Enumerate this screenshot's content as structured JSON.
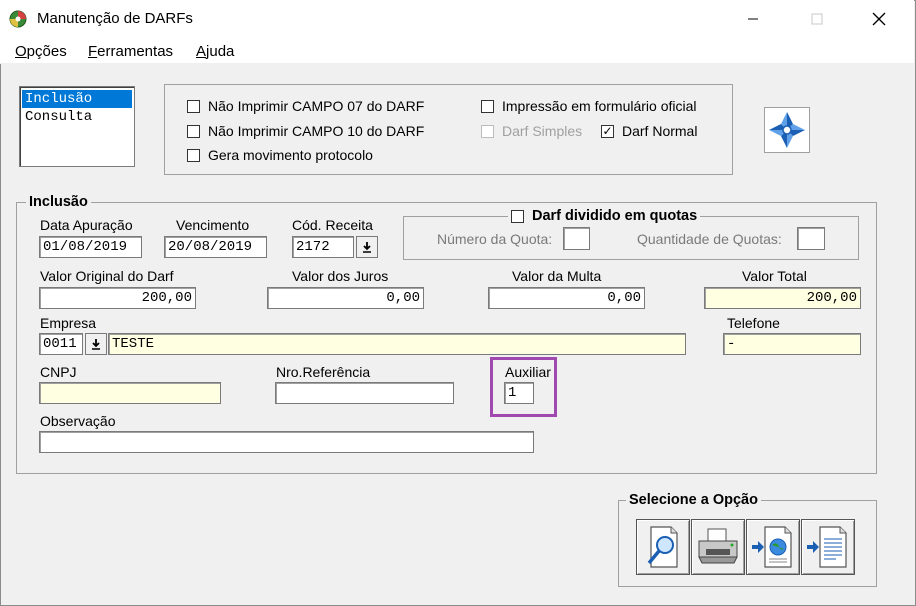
{
  "window": {
    "title": "Manutenção de DARFs",
    "minimize": "—",
    "maximize": "☐",
    "close": "✕"
  },
  "menu": [
    {
      "u": "O",
      "rest": "pções"
    },
    {
      "u": "F",
      "rest": "erramentas"
    },
    {
      "u": "A",
      "rest": "juda"
    }
  ],
  "modes": [
    "Inclusão",
    "Consulta"
  ],
  "options": {
    "nao_imprimir_07": "Não Imprimir CAMPO 07 do DARF",
    "nao_imprimir_10": "Não Imprimir CAMPO 10 do DARF",
    "gera_movimento": "Gera movimento protocolo",
    "impressao_oficial": "Impressão em formulário oficial",
    "darf_simples": "Darf Simples",
    "darf_normal": "Darf Normal",
    "darf_normal_check": "✓"
  },
  "inclusao": {
    "title": "Inclusão",
    "data_apuracao_label": "Data Apuração",
    "data_apuracao": "01/08/2019",
    "vencimento_label": "Vencimento",
    "vencimento": "20/08/2019",
    "cod_receita_label": "Cód. Receita",
    "cod_receita": "2172",
    "quotas_title": "Darf dividido em quotas",
    "numero_quota_label": "Número da Quota:",
    "qtd_quotas_label": "Quantidade de Quotas:",
    "valor_original_label": "Valor Original do Darf",
    "valor_original": "200,00",
    "valor_juros_label": "Valor dos Juros",
    "valor_juros": "0,00",
    "valor_multa_label": "Valor da Multa",
    "valor_multa": "0,00",
    "valor_total_label": "Valor Total",
    "valor_total": "200,00",
    "empresa_label": "Empresa",
    "empresa_codigo": "0011",
    "empresa_nome": "TESTE",
    "telefone_label": "Telefone",
    "telefone": "-",
    "cnpj_label": "CNPJ",
    "cnpj": "",
    "nro_referencia_label": "Nro.Referência",
    "nro_referencia": "",
    "auxiliar_label": "Auxiliar",
    "auxiliar": "1",
    "observacao_label": "Observação",
    "observacao": ""
  },
  "selecione": {
    "title": "Selecione a Opção"
  },
  "colors": {
    "highlight": "#a04ab0",
    "selection": "#0078d7",
    "readonly_yellow": "#ffffe1"
  }
}
